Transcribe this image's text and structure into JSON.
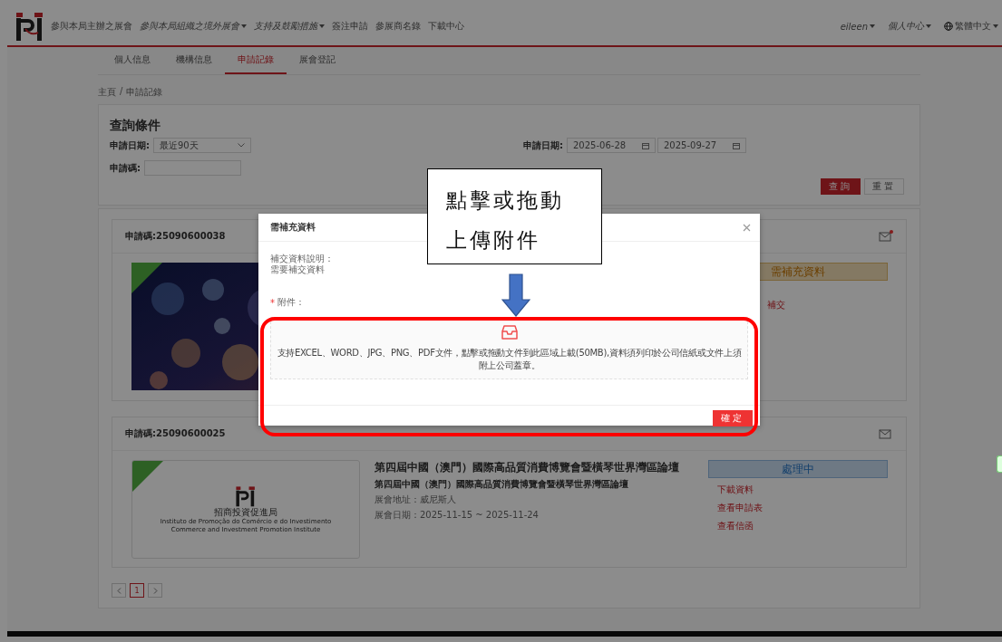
{
  "header": {
    "nav": [
      {
        "label": "參與本局主辦之展會",
        "dropdown": false,
        "italic": false
      },
      {
        "label": "參與本局組織之境外展會",
        "dropdown": true,
        "italic": true
      },
      {
        "label": "支持及鼓勵措施",
        "dropdown": true,
        "italic": true
      },
      {
        "label": "簽注申請",
        "dropdown": false,
        "italic": false
      },
      {
        "label": "參展商名錄",
        "dropdown": false,
        "italic": false
      },
      {
        "label": "下載中心",
        "dropdown": false,
        "italic": false
      }
    ],
    "user": "eileen",
    "user_menu": "個人中心",
    "language": "繁體中文"
  },
  "tabs": [
    {
      "label": "個人信息",
      "selected": false
    },
    {
      "label": "機構信息",
      "selected": false
    },
    {
      "label": "申請記錄",
      "selected": true
    },
    {
      "label": "展會登記",
      "selected": false
    }
  ],
  "breadcrumb": {
    "items": [
      "主頁",
      "申請記錄"
    ],
    "separator": "/"
  },
  "query": {
    "title": "查詢條件",
    "date_label": "申請日期:",
    "date_range": "最近90天",
    "date_label_2": "申請日期:",
    "date_from": "2025-06-28",
    "date_to": "2025-09-27",
    "code_label": "申請碼:",
    "buttons": [
      {
        "label": "查詢",
        "kind": "primary"
      },
      {
        "label": "重置",
        "kind": "default"
      }
    ]
  },
  "records": [
    {
      "code": "申請碼:25090600038",
      "kind": "picture",
      "unread": true,
      "status": "需補充資料",
      "color": "#847963",
      "links": [
        "補交"
      ]
    },
    {
      "code": "申請碼:25090600025",
      "kind": "logo",
      "unread": false,
      "logo_texts": [
        "招商投資促進局",
        "Instituto de Promoção do Comércio e do Investimento",
        "Commerce and Investment Promotion Institute"
      ],
      "title": "第四屆中國（澳門）國際高品質消費博覽會暨橫琴世界灣區論壇",
      "subtitle": "第四屆中國（澳門）國際高品質消費博覽會暨橫琴世界灣區論壇",
      "details": [
        "展會地址：威尼斯人",
        "展會日期：2025-11-15 ~ 2025-11-24"
      ],
      "status": "處理中",
      "color": "#6e7984",
      "links": [
        "下載資料",
        "查看申請表",
        "查看信函"
      ]
    }
  ],
  "pagination": {
    "pages": [
      {
        "label": "1",
        "selected": true
      }
    ]
  },
  "modal": {
    "title": "需補充資料",
    "note_label": "補交資料說明：",
    "note": "需要補交資料",
    "attachment_label": "附件：",
    "required_mark": "*",
    "dropzone_text": "支持EXCEL、WORD、JPG、PNG、PDF文件，點擊或拖動文件到此區域上載(50MB),資料須列印於公司信紙或文件上須附上公司蓋章。",
    "confirm": "確定"
  },
  "annotation": {
    "lines": [
      "點擊或拖動",
      "上傳附件"
    ]
  }
}
